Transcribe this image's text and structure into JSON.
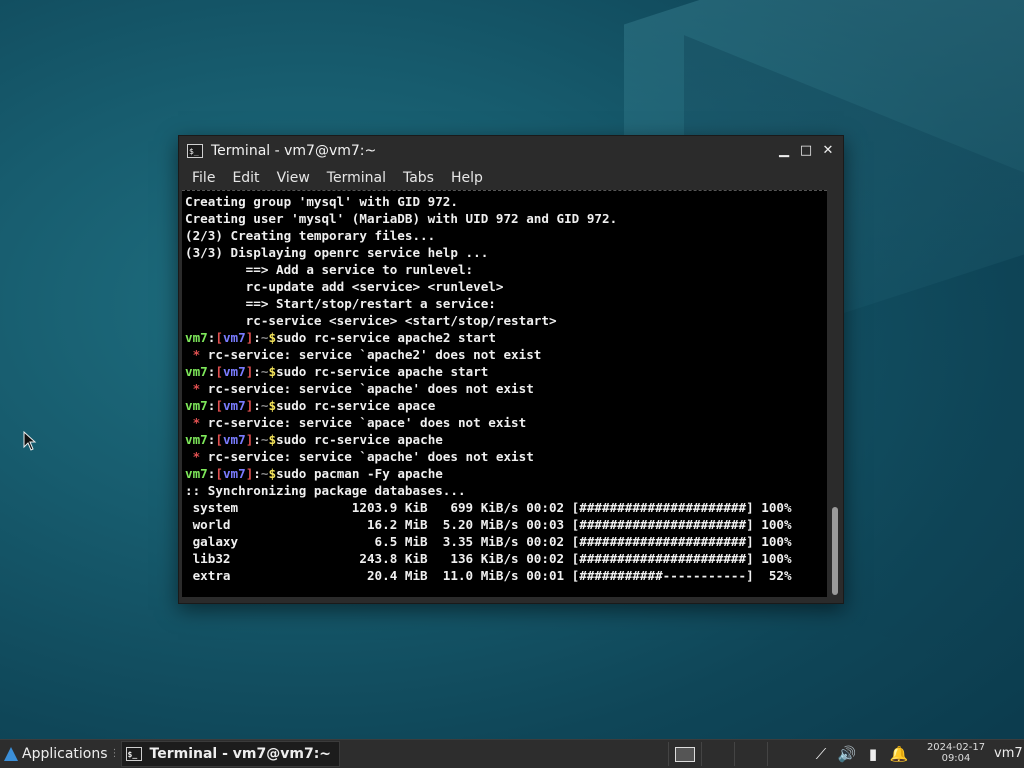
{
  "window": {
    "title": "Terminal - vm7@vm7:~",
    "icon": "terminal-icon",
    "icon_glyph": "$_",
    "controls": {
      "minimize": "minimize-icon",
      "maximize": "maximize-icon",
      "close": "close-icon"
    },
    "control_glyphs": {
      "minimize": "▁",
      "maximize": "□",
      "close": "✕"
    }
  },
  "menu": [
    "File",
    "Edit",
    "View",
    "Terminal",
    "Tabs",
    "Help"
  ],
  "terminal": {
    "prompt": {
      "user": "vm7",
      "host": "vm7",
      "path": "~",
      "symbol": "$"
    },
    "lines": [
      {
        "type": "out",
        "text": "Creating group 'mysql' with GID 972."
      },
      {
        "type": "out",
        "text": "Creating user 'mysql' (MariaDB) with UID 972 and GID 972."
      },
      {
        "type": "out",
        "text": "(2/3) Creating temporary files..."
      },
      {
        "type": "out",
        "text": "(3/3) Displaying openrc service help ..."
      },
      {
        "type": "out",
        "text": "        ==> Add a service to runlevel:"
      },
      {
        "type": "out",
        "text": "        rc-update add <service> <runlevel>"
      },
      {
        "type": "out",
        "text": "        ==> Start/stop/restart a service:"
      },
      {
        "type": "out",
        "text": "        rc-service <service> <start/stop/restart>"
      },
      {
        "type": "cmd",
        "text": "sudo rc-service apache2 start"
      },
      {
        "type": "err",
        "text": "rc-service: service `apache2' does not exist"
      },
      {
        "type": "cmd",
        "text": "sudo rc-service apache start"
      },
      {
        "type": "err",
        "text": "rc-service: service `apache' does not exist"
      },
      {
        "type": "cmd",
        "text": "sudo rc-service apace"
      },
      {
        "type": "err",
        "text": "rc-service: service `apace' does not exist"
      },
      {
        "type": "cmd",
        "text": "sudo rc-service apache"
      },
      {
        "type": "err",
        "text": "rc-service: service `apache' does not exist"
      },
      {
        "type": "cmd",
        "text": "sudo pacman -Fy apache"
      },
      {
        "type": "out",
        "text": ":: Synchronizing package databases..."
      },
      {
        "type": "out",
        "text": " system               1203.9 KiB   699 KiB/s 00:02 [######################] 100%"
      },
      {
        "type": "out",
        "text": " world                  16.2 MiB  5.20 MiB/s 00:03 [######################] 100%"
      },
      {
        "type": "out",
        "text": " galaxy                  6.5 MiB  3.35 MiB/s 00:02 [######################] 100%"
      },
      {
        "type": "out",
        "text": " lib32                 243.8 KiB   136 KiB/s 00:02 [######################] 100%"
      },
      {
        "type": "out",
        "text": " extra                  20.4 MiB  11.0 MiB/s 00:01 [###########-----------]  52%"
      }
    ]
  },
  "panel": {
    "applications_label": "Applications",
    "applications_sep": "⋮",
    "task_label": "Terminal - vm7@vm7:~",
    "workspaces": 4,
    "active_workspace": 1,
    "tray_icons": [
      "network-icon",
      "volume-icon",
      "battery-icon",
      "notification-icon"
    ],
    "tray_glyphs": [
      "⟋",
      "🔊",
      "▮",
      "🔔"
    ],
    "clock_date": "2024-02-17",
    "clock_time": "09:04",
    "user": "vm7"
  }
}
